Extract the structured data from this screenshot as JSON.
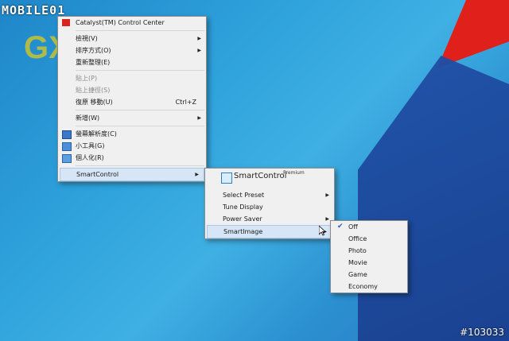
{
  "watermark": {
    "logo": "MOBILE01",
    "id": "#103033"
  },
  "wallpaper_text": "GXDVD",
  "context_menu": {
    "header": "Catalyst(TM) Control Center",
    "items": [
      {
        "label": "檢視(V)",
        "submenu": true
      },
      {
        "label": "排序方式(O)",
        "submenu": true
      },
      {
        "label": "重新整理(E)"
      },
      {
        "label": "貼上(P)",
        "disabled": true
      },
      {
        "label": "貼上捷徑(S)",
        "disabled": true
      },
      {
        "label": "復原 移動(U)",
        "shortcut": "Ctrl+Z"
      },
      {
        "label": "新增(W)",
        "submenu": true
      },
      {
        "label": "螢幕解析度(C)"
      },
      {
        "label": "小工具(G)"
      },
      {
        "label": "個人化(R)"
      },
      {
        "label": "SmartControl",
        "submenu": true
      }
    ]
  },
  "smartcontrol_menu": {
    "logo": "SmartControl",
    "logo_suffix": "Premium",
    "items": [
      {
        "label": "Select Preset",
        "submenu": true
      },
      {
        "label": "Tune Display"
      },
      {
        "label": "Power Saver",
        "submenu": true
      },
      {
        "label": "SmartImage",
        "submenu": true
      }
    ]
  },
  "smartimage_menu": {
    "items": [
      "Off",
      "Office",
      "Photo",
      "Movie",
      "Game",
      "Economy"
    ],
    "checked": "Off"
  },
  "colors": {
    "desktop": "#2fa3dc",
    "menu_bg": "#f0f0f0",
    "highlight": "#d7e6f7",
    "accent_red": "#e0201a"
  }
}
